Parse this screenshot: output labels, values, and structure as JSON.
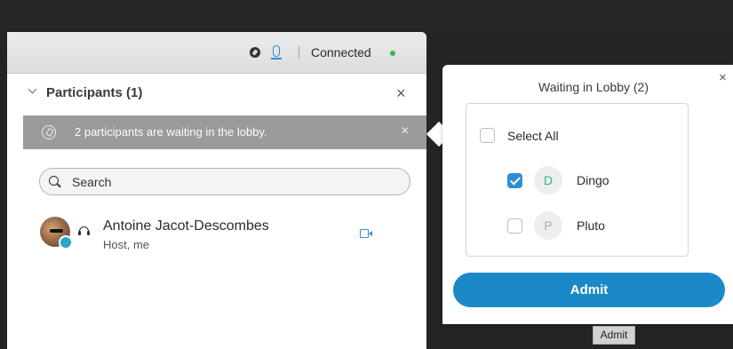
{
  "toolbar": {
    "status_text": "Connected",
    "status_color": "#2eb847",
    "icons": [
      "record-icon",
      "microphone-icon"
    ]
  },
  "participants_panel": {
    "title": "Participants (1)",
    "banner": {
      "text": "2 participants are waiting in the lobby.",
      "close_label": "×"
    },
    "close_label": "×",
    "search": {
      "value": "",
      "placeholder": "Search"
    },
    "participants": [
      {
        "name": "Antoine Jacot-Descombes",
        "role": "Host, me"
      }
    ]
  },
  "lobby": {
    "title": "Waiting in Lobby (2)",
    "close_label": "×",
    "select_all_label": "Select All",
    "entries": [
      {
        "initial": "D",
        "name": "Dingo",
        "checked": true,
        "initial_color": "#2fb19a"
      },
      {
        "initial": "P",
        "name": "Pluto",
        "checked": false,
        "initial_color": "#aaaaaa"
      }
    ],
    "admit_label": "Admit",
    "accent_color": "#1b88c7"
  },
  "tooltip": {
    "text": "Admit"
  }
}
